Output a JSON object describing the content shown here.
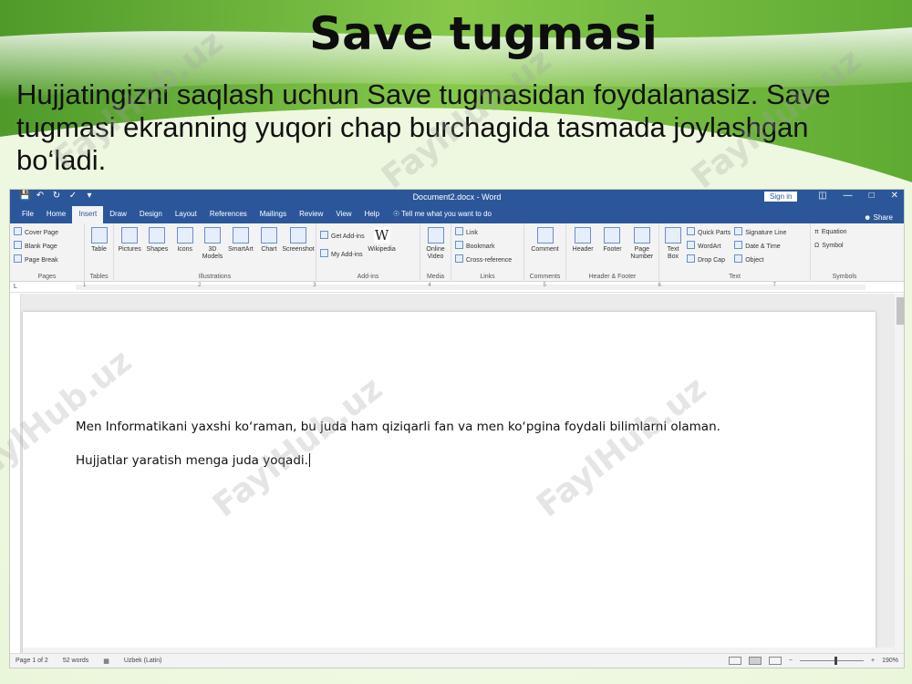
{
  "slide": {
    "title": "Save tugmasi",
    "body": "Hujjatingizni saqlash uchun Save tugmasidan foydalanasiz. Save tugmasi ekranning yuqori chap burchagida tasmada joylashgan bo‘ladi.",
    "watermark": "FaylHub.uz",
    "colors": {
      "background_green": "#7cc142",
      "title": "#0d0d0d"
    }
  },
  "word": {
    "title": "Document2.docx - Word",
    "sign_in": "Sign in",
    "share": "Share",
    "tell_me": "Tell me what you want to do",
    "colors": {
      "accent": "#2b579a",
      "ribbon": "#f3f3f3"
    },
    "tabs": [
      "File",
      "Home",
      "Insert",
      "Draw",
      "Design",
      "Layout",
      "References",
      "Mailings",
      "Review",
      "View",
      "Help"
    ],
    "active_tab": "Insert",
    "ribbon": {
      "pages": {
        "label": "Pages",
        "items": [
          "Cover Page",
          "Blank Page",
          "Page Break"
        ]
      },
      "tables": {
        "label": "Tables",
        "items": [
          "Table"
        ]
      },
      "illustrations": {
        "label": "Illustrations",
        "items": [
          "Pictures",
          "Shapes",
          "Icons",
          "3D Models",
          "SmartArt",
          "Chart",
          "Screenshot"
        ]
      },
      "addins": {
        "label": "Add-ins",
        "items": [
          "Get Add-ins",
          "My Add-ins",
          "Wikipedia"
        ]
      },
      "media": {
        "label": "Media",
        "items": [
          "Online Video"
        ]
      },
      "links": {
        "label": "Links",
        "items": [
          "Link",
          "Bookmark",
          "Cross-reference"
        ]
      },
      "comments": {
        "label": "Comments",
        "items": [
          "Comment"
        ]
      },
      "header_footer": {
        "label": "Header & Footer",
        "items": [
          "Header",
          "Footer",
          "Page Number"
        ]
      },
      "text": {
        "label": "Text",
        "items": [
          "Text Box",
          "Quick Parts",
          "WordArt",
          "Drop Cap",
          "Signature Line",
          "Date & Time",
          "Object"
        ]
      },
      "symbols": {
        "label": "Symbols",
        "items": [
          "Equation",
          "Symbol"
        ]
      }
    },
    "ruler_marks": [
      "1",
      "2",
      "3",
      "4",
      "5",
      "6",
      "7"
    ],
    "document": {
      "paragraphs": [
        "Men Informatikani yaxshi koʻraman, bu juda ham qiziqarli fan va men koʻpgina foydali bilimlarni olaman.",
        "Hujjatlar yaratish menga juda yoqadi."
      ]
    },
    "status": {
      "page": "Page 1 of 2",
      "words": "52 words",
      "language": "Uzbek (Latin)",
      "zoom": "190%"
    }
  }
}
